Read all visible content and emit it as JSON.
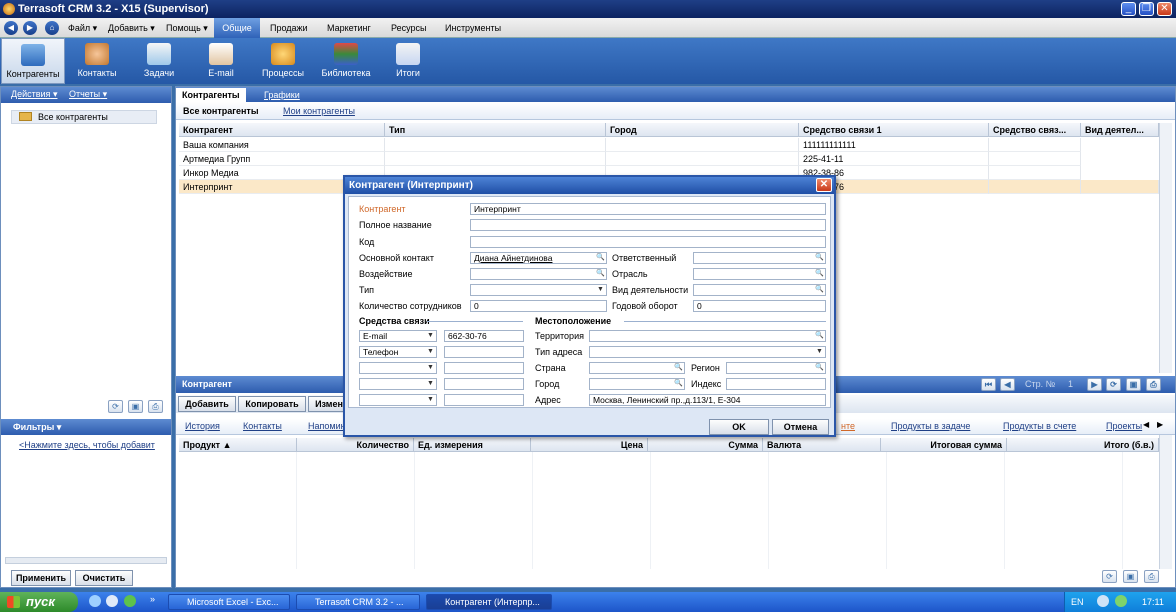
{
  "window": {
    "title": "Terrasoft CRM 3.2 - X15 (Supervisor)",
    "min": "_",
    "restore": "❐",
    "close": "✕"
  },
  "menu": {
    "items": [
      "Файл",
      "Добавить",
      "Помощь",
      "Общие",
      "Продажи",
      "Маркетинг",
      "Ресурсы",
      "Инструменты"
    ]
  },
  "ribbon": {
    "items": [
      "Контрагенты",
      "Контакты",
      "Задачи",
      "E-mail",
      "Процессы",
      "Библиотека",
      "Итоги"
    ]
  },
  "left": {
    "actions": "Действия",
    "reports": "Отчеты",
    "tree_item": "Все контрагенты",
    "filters": "Фильтры",
    "filter_hint": "<Нажмите здесь, чтобы добавит",
    "apply": "Применить",
    "clear": "Очистить"
  },
  "main": {
    "tabs": [
      "Контрагенты",
      "Графики"
    ],
    "subtabs": [
      "Все контрагенты",
      "Мои контрагенты"
    ],
    "columns": [
      "Контрагент",
      "Тип",
      "Город",
      "Средство связи 1",
      "Средство связ...",
      "Вид деятел..."
    ],
    "rows": [
      {
        "name": "Ваша компания",
        "contact": "111111111111"
      },
      {
        "name": "Артмедиа Групп",
        "contact": "225-41-11"
      },
      {
        "name": "Инкор Медиа",
        "contact": "982-38-86"
      },
      {
        "name": "Интерпринт",
        "contact": "662-30-76"
      }
    ],
    "footer_label": "Контрагент",
    "page_label": "Стр. №",
    "page_num": "1",
    "buttons": [
      "Добавить",
      "Копировать",
      "Измен"
    ],
    "bottom_tabs": [
      "История",
      "Контакты",
      "Напомин",
      "нте",
      "Продукты в задаче",
      "Продукты в счете",
      "Проекты"
    ],
    "bottom_columns": [
      "Продукт",
      "Количество",
      "Ед. измерения",
      "Цена",
      "Сумма",
      "Валюта",
      "Итоговая сумма",
      "Итого (б.в.)"
    ]
  },
  "dialog": {
    "title": "Контрагент (Интерпринт)",
    "labels": {
      "account": "Контрагент",
      "full_name": "Полное название",
      "code": "Код",
      "main_contact": "Основной контакт",
      "responsible": "Ответственный",
      "impact": "Воздействие",
      "industry": "Отрасль",
      "type": "Тип",
      "activity": "Вид деятельности",
      "employees": "Количество сотрудников",
      "turnover": "Годовой оборот",
      "comm_section": "Средства связи",
      "location_section": "Местоположение",
      "territory": "Территория",
      "address_type": "Тип адреса",
      "country": "Страна",
      "region": "Регион",
      "city": "Город",
      "index": "Индекс",
      "address": "Адрес"
    },
    "values": {
      "account": "Интерпринт",
      "main_contact": "Диана Айнетдинова",
      "employees": "0",
      "turnover": "0",
      "comm1_type": "E-mail",
      "comm1_value": "662-30-76",
      "comm2_type": "Телефон",
      "address": "Москва, Ленинский пр.,д.113/1, Е-304"
    },
    "ok": "OK",
    "cancel": "Отмена"
  },
  "taskbar": {
    "start": "пуск",
    "tasks": [
      "Microsoft Excel - Exc...",
      "Terrasoft CRM 3.2 - ...",
      "Контрагент (Интерпр..."
    ],
    "lang": "EN",
    "time": "17:11"
  },
  "colors": {
    "accent": "#2d5cae",
    "selected_row": "#fbe8c8",
    "account_label": "#d0682a"
  }
}
